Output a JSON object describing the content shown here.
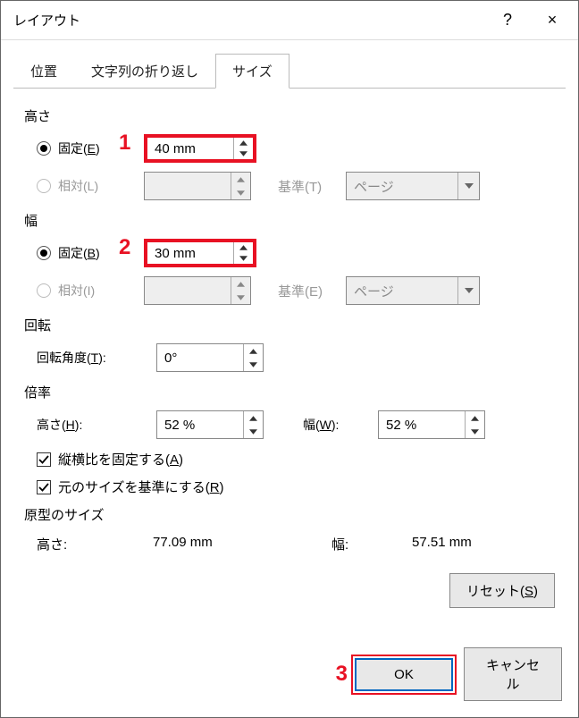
{
  "titlebar": {
    "title": "レイアウト",
    "help": "?",
    "close": "×"
  },
  "tabs": {
    "position": "位置",
    "wrap": "文字列の折り返し",
    "size": "サイズ"
  },
  "callouts": {
    "one": "1",
    "two": "2",
    "three": "3"
  },
  "height": {
    "section": "高さ",
    "fixed_label_pre": "固定(",
    "fixed_key": "E",
    "fixed_label_post": ")",
    "fixed_value": "40 mm",
    "rel_label": "相対(L)",
    "rel_value": "",
    "base_label": "基準(T)",
    "base_value": "ページ"
  },
  "width": {
    "section": "幅",
    "fixed_label_pre": "固定(",
    "fixed_key": "B",
    "fixed_label_post": ")",
    "fixed_value": "30 mm",
    "rel_label": "相対(I)",
    "rel_value": "",
    "base_label": "基準(E)",
    "base_value": "ページ"
  },
  "rotation": {
    "section": "回転",
    "label_pre": "回転角度(",
    "key": "T",
    "label_post": "):",
    "value": "0°"
  },
  "scale": {
    "section": "倍率",
    "h_label_pre": "高さ(",
    "h_key": "H",
    "h_label_post": "):",
    "h_value": "52 %",
    "w_label_pre": "幅(",
    "w_key": "W",
    "w_label_post": "):",
    "w_value": "52 %",
    "lock_pre": "縦横比を固定する(",
    "lock_key": "A",
    "lock_post": ")",
    "orig_pre": "元のサイズを基準にする(",
    "orig_key": "R",
    "orig_post": ")"
  },
  "original": {
    "section": "原型のサイズ",
    "h_label": "高さ:",
    "h_value": "77.09 mm",
    "w_label": "幅:",
    "w_value": "57.51 mm"
  },
  "buttons": {
    "reset_pre": "リセット(",
    "reset_key": "S",
    "reset_post": ")",
    "ok": "OK",
    "cancel": "キャンセル"
  }
}
